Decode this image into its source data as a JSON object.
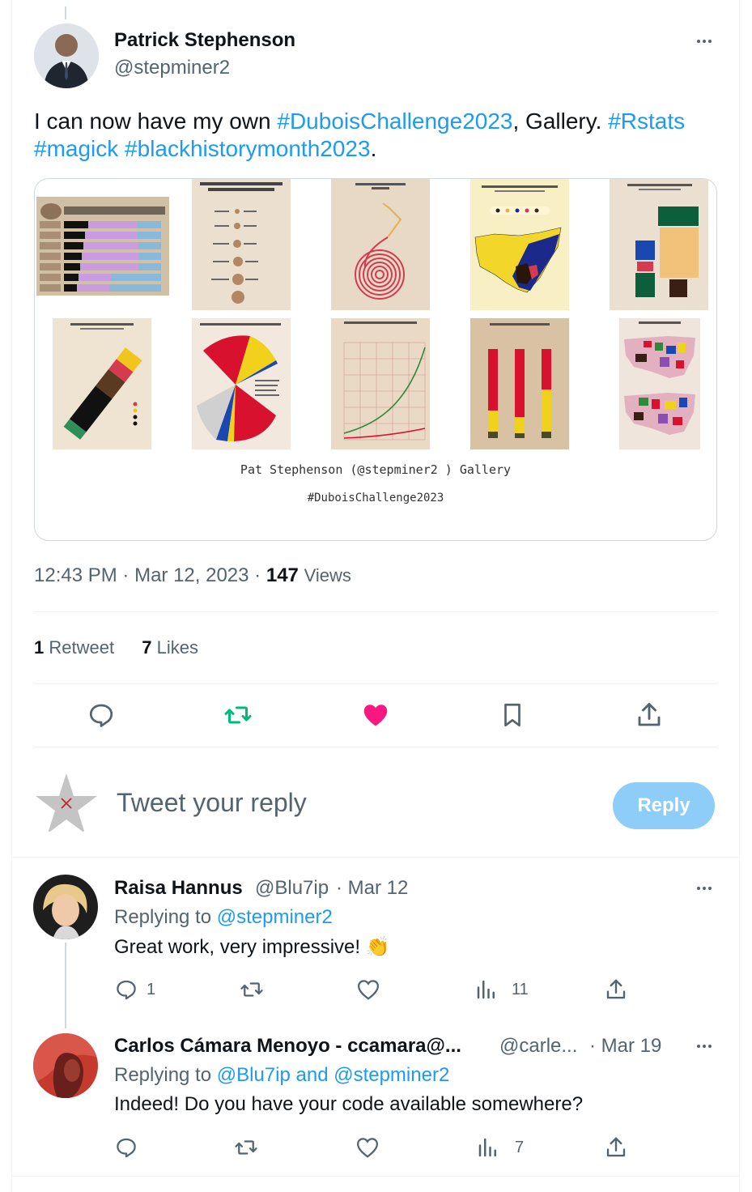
{
  "tweet": {
    "author_name": "Patrick Stephenson",
    "author_handle": "@stepminer2",
    "text_parts": [
      "I can now have my own ",
      "#DuboisChallenge2023",
      ", Gallery. ",
      "#Rstats",
      "#magick",
      "#blackhistorymonth2023",
      "."
    ],
    "media_caption_1": "Pat Stephenson (@stepminer2 ) Gallery",
    "media_caption_2": "#DuboisChallenge2023",
    "time": "12:43 PM",
    "date": "Mar 12, 2023",
    "views_count": "147",
    "views_label": "Views",
    "retweets_count": "1",
    "retweets_label": "Retweet",
    "likes_count": "7",
    "likes_label": "Likes",
    "dot": "·"
  },
  "composer": {
    "placeholder": "Tweet your reply",
    "button_label": "Reply"
  },
  "replies": [
    {
      "name": "Raisa Hannus",
      "handle": "@Blu7ip",
      "date": "· Mar 12",
      "replying_prefix": "Replying to ",
      "replying_to": "@stepminer2",
      "text": "Great work, very impressive! 👏",
      "reply_count": "1",
      "views_count": "11"
    },
    {
      "name": "Carlos Cámara Menoyo - ccamara@...",
      "handle": "@carle...",
      "date": "· Mar 19",
      "replying_prefix": "Replying to ",
      "replying_to": "@Blu7ip and @stepminer2",
      "text": "Indeed! Do you have your code available somewhere?",
      "reply_count": "",
      "views_count": "7"
    }
  ],
  "colors": {
    "accent": "#1d9bf0",
    "like_active": "#f91880",
    "retweet_active": "#00ba7c",
    "reply_button": "#8ecdf8"
  }
}
